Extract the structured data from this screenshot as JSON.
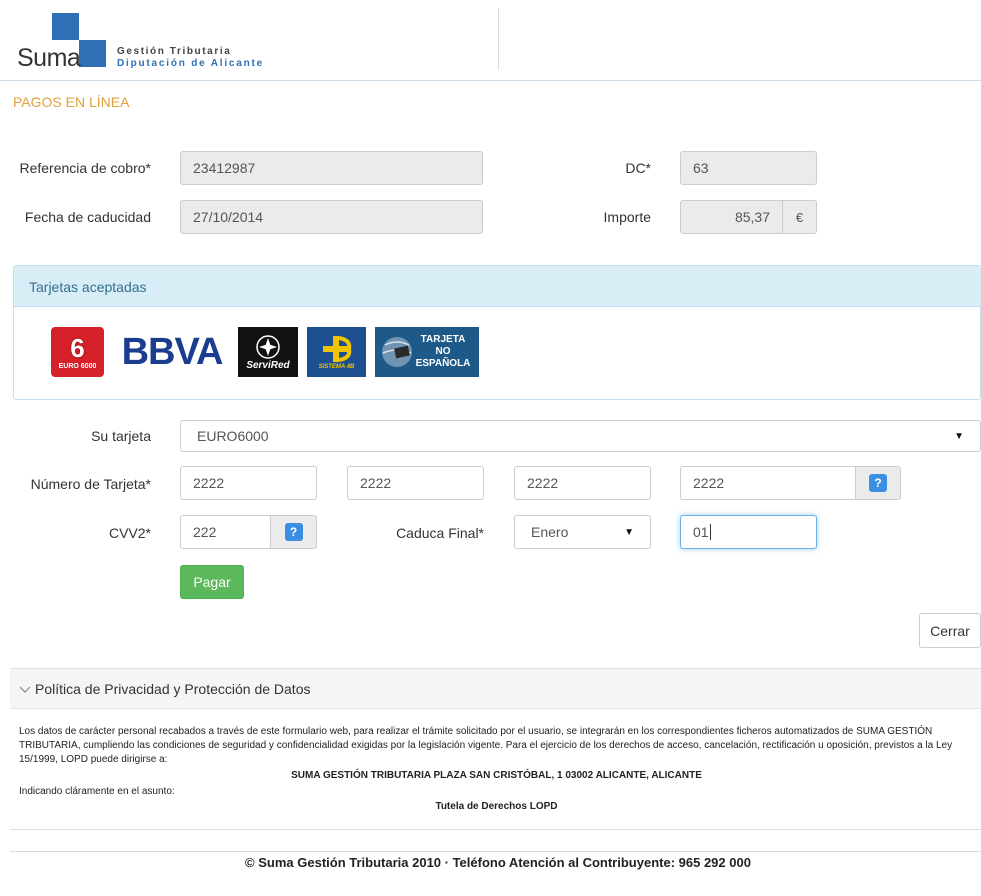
{
  "brand": {
    "name": "Suma",
    "line1": "Gestión Tributaria",
    "line2": "Diputación de Alicante",
    "color": "#2e6fb5"
  },
  "page_title": "PAGOS EN LÍNEA",
  "payment": {
    "ref_label": "Referencia de cobro*",
    "ref_value": "23412987",
    "dc_label": "DC*",
    "dc_value": "63",
    "fecha_label": "Fecha de caducidad",
    "fecha_value": "27/10/2014",
    "importe_label": "Importe",
    "importe_value": "85,37",
    "currency": "€"
  },
  "cards_panel": {
    "title": "Tarjetas aceptadas",
    "cards": [
      {
        "name": "euro6000-logo",
        "text": "6",
        "sub": "EURO 6000"
      },
      {
        "name": "bbva-logo",
        "text": "BBVA"
      },
      {
        "name": "servired-logo",
        "text": "ServiRed"
      },
      {
        "name": "sistema4b-logo",
        "text": "SISTEMA 4B"
      },
      {
        "name": "tarjeta-no-espanola-logo",
        "text": "TARJETA NO ESPAÑOLA"
      }
    ]
  },
  "form": {
    "card_label": "Su tarjeta",
    "card_selected": "EURO6000",
    "number_label": "Número de Tarjeta*",
    "number_parts": [
      "2222",
      "2222",
      "2222",
      "2222"
    ],
    "cvv_label": "CVV2*",
    "cvv_value": "222",
    "expiry_label": "Caduca Final*",
    "expiry_month": "Enero",
    "expiry_year": "01",
    "help_glyph": "?",
    "pay_label": "Pagar",
    "close_label": "Cerrar"
  },
  "privacy": {
    "title": "Política de Privacidad y Protección de Datos",
    "paragraph": "Los datos de carácter personal recabados a través de este formulario web, para realizar el trámite solicitado por el usuario, se integrarán en los correspondientes ficheros automatizados de SUMA GESTIÓN TRIBUTARIA, cumpliendo las condiciones de seguridad y confidencialidad exigidas por la legislación vigente. Para el ejercicio de los derechos de acceso, cancelación, rectificación u oposición, previstos a la Ley 15/1999, LOPD puede dirigirse a:",
    "address": "SUMA GESTIÓN TRIBUTARIA PLAZA SAN CRISTÓBAL, 1 03002 ALICANTE, ALICANTE",
    "subject_label": "Indicando cláramente en el asunto:",
    "subject": "Tutela de Derechos LOPD"
  },
  "footer": "© Suma Gestión Tributaria 2010 · Teléfono Atención al Contribuyente: 965 292 000",
  "colors": {
    "accent": "#e0a13a",
    "panel": "#d9edf7",
    "button_primary": "#5cb85c",
    "help_button": "#3b8fe3"
  }
}
